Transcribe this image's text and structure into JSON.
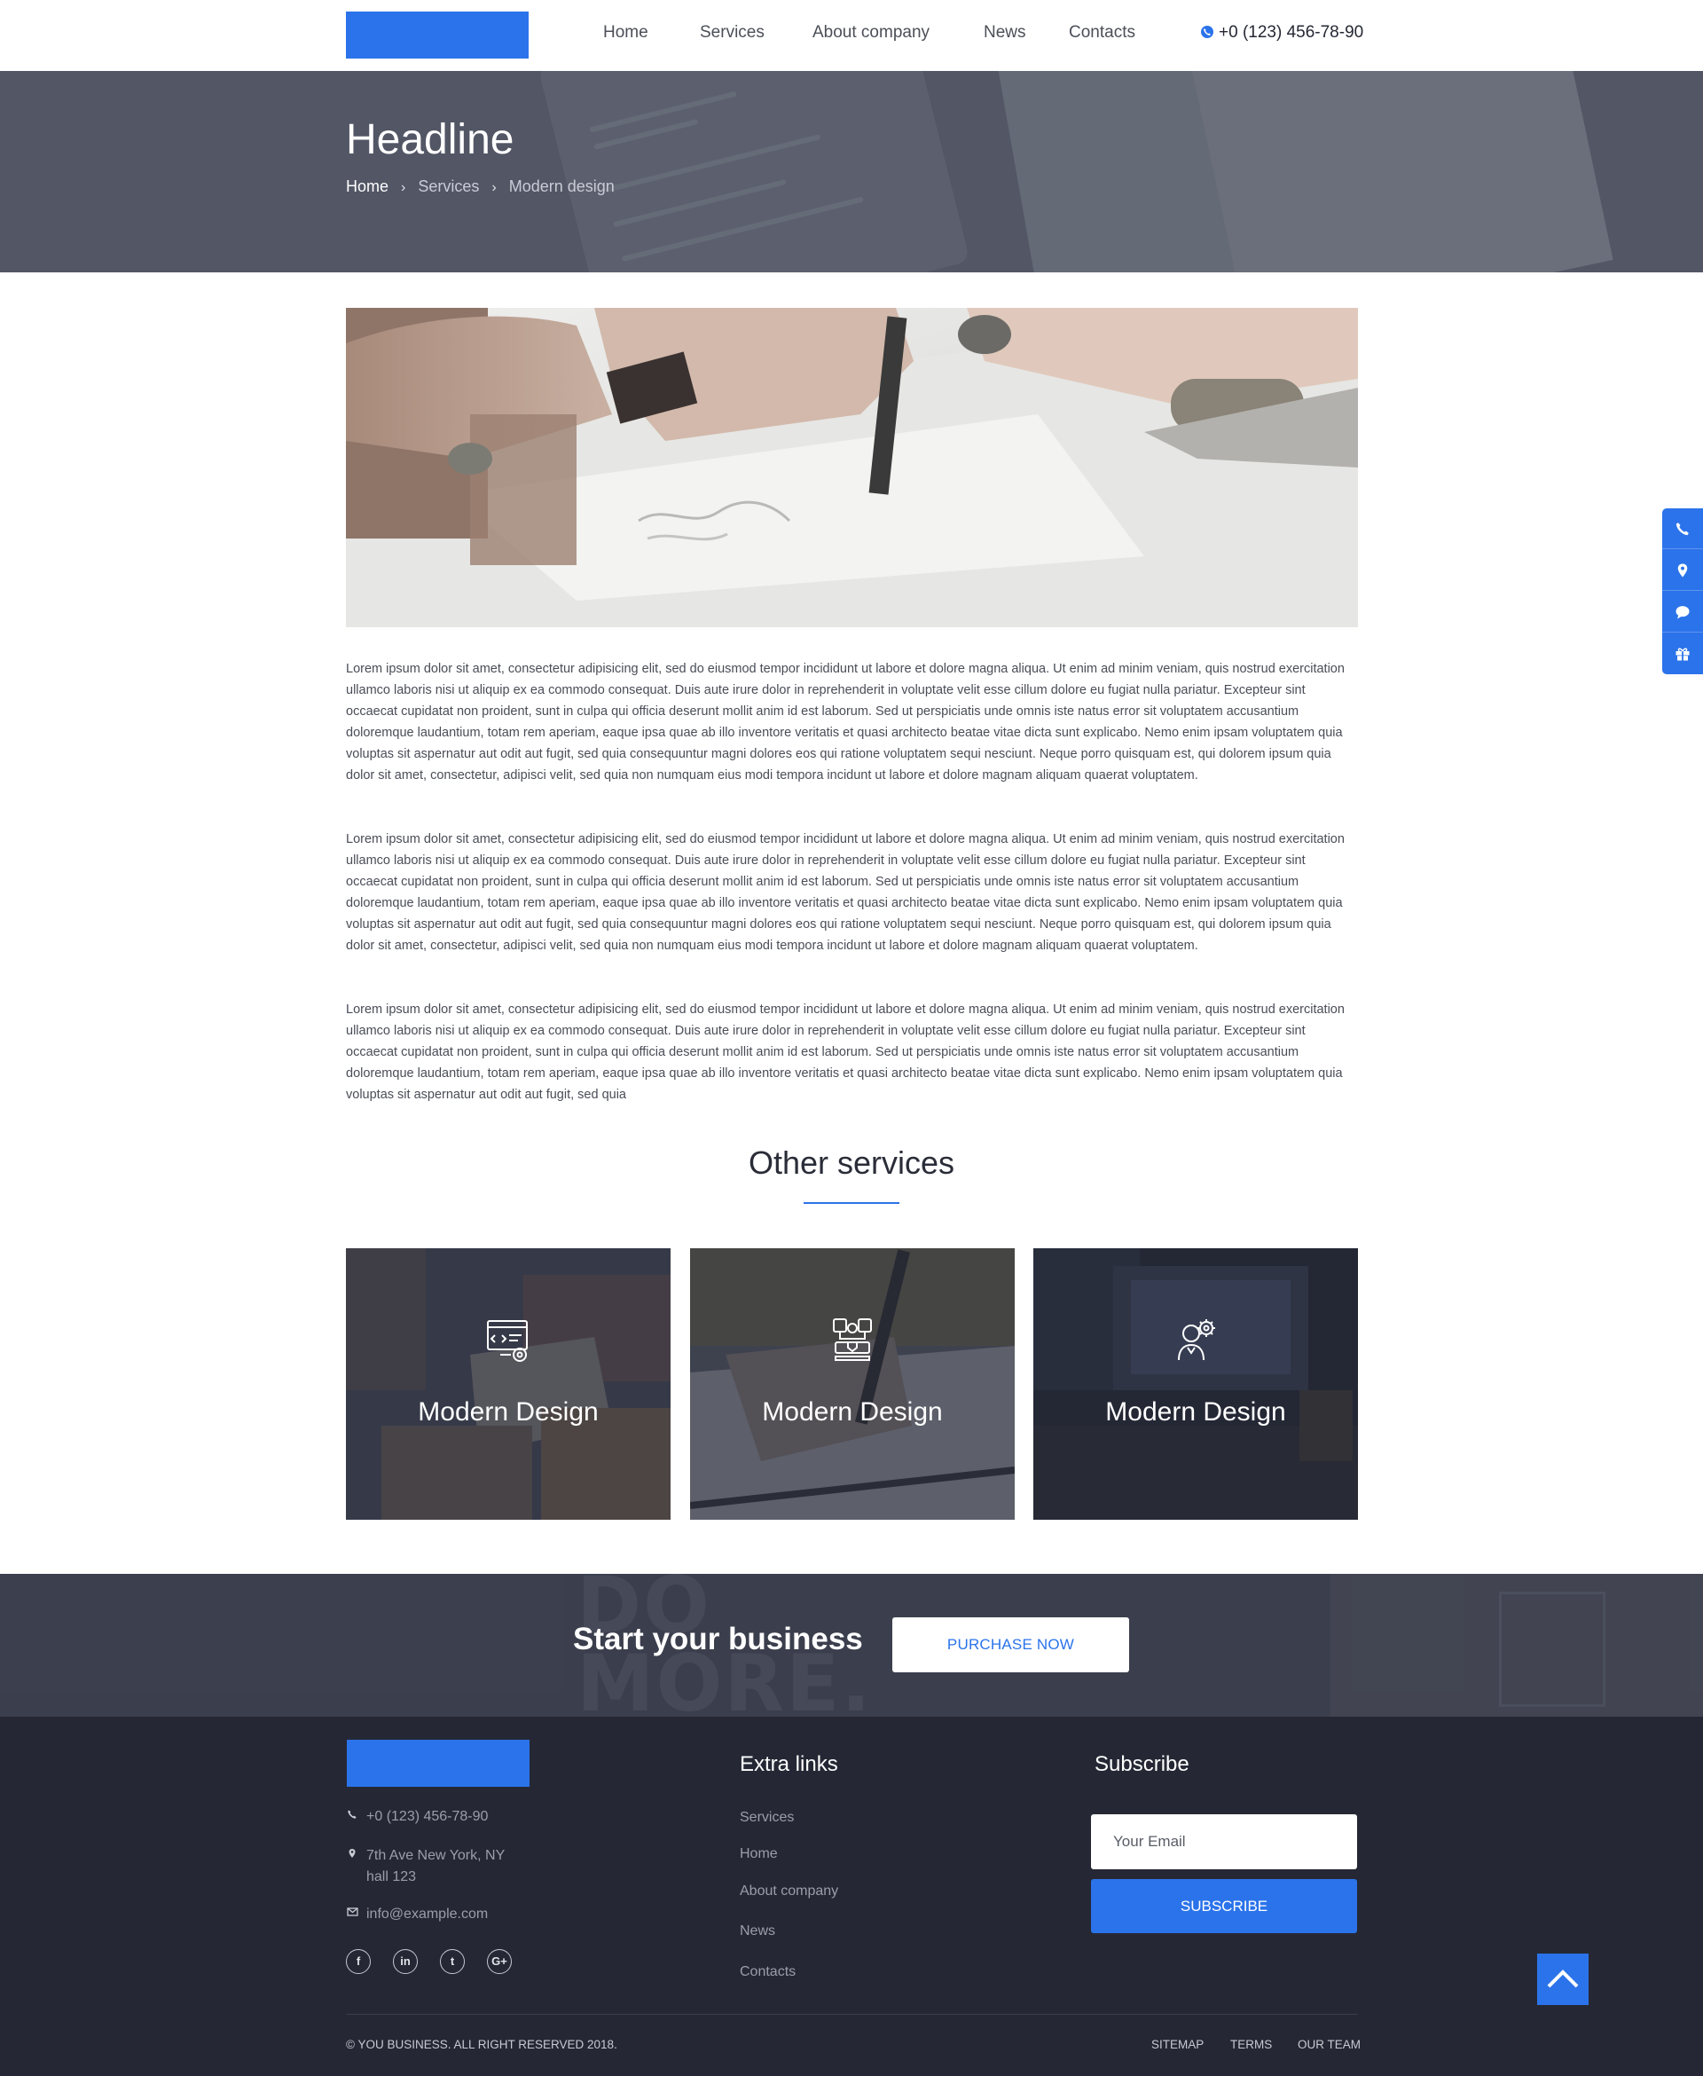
{
  "header": {
    "nav": [
      "Home",
      "Services",
      "About company",
      "News",
      "Contacts"
    ],
    "phone": "+0 (123) 456-78-90",
    "phone_icon": "phone-icon"
  },
  "hero": {
    "title": "Headline",
    "breadcrumbs": [
      "Home",
      "Services",
      "Modern design"
    ]
  },
  "content": {
    "paragraphs": [
      "Lorem ipsum dolor sit amet, consectetur adipisicing elit, sed do eiusmod tempor incididunt ut labore et dolore magna aliqua. Ut enim ad minim veniam, quis nostrud exercitation ullamco laboris nisi ut aliquip ex ea commodo consequat. Duis aute irure dolor in reprehenderit in voluptate velit esse cillum dolore eu fugiat nulla pariatur. Excepteur sint occaecat cupidatat non proident, sunt in culpa qui officia deserunt mollit anim id est laborum. Sed ut perspiciatis unde omnis iste natus error sit voluptatem accusantium doloremque laudantium, totam rem aperiam, eaque ipsa quae ab illo inventore veritatis et quasi architecto beatae vitae dicta sunt explicabo. Nemo enim ipsam voluptatem quia voluptas sit aspernatur aut odit aut fugit, sed quia consequuntur magni dolores eos qui ratione voluptatem sequi nesciunt. Neque porro quisquam est, qui dolorem ipsum quia dolor sit amet, consectetur, adipisci velit, sed quia non numquam eius modi tempora incidunt ut labore et dolore magnam aliquam quaerat voluptatem.",
      "Lorem ipsum dolor sit amet, consectetur adipisicing elit, sed do eiusmod tempor incididunt ut labore et dolore magna aliqua. Ut enim ad minim veniam, quis nostrud exercitation ullamco laboris nisi ut aliquip ex ea commodo consequat. Duis aute irure dolor in reprehenderit in voluptate velit esse cillum dolore eu fugiat nulla pariatur. Excepteur sint occaecat cupidatat non proident, sunt in culpa qui officia deserunt mollit anim id est laborum. Sed ut perspiciatis unde omnis iste natus error sit voluptatem accusantium doloremque laudantium, totam rem aperiam, eaque ipsa quae ab illo inventore veritatis et quasi architecto beatae vitae dicta sunt explicabo. Nemo enim ipsam voluptatem quia voluptas sit aspernatur aut odit aut fugit, sed quia consequuntur magni dolores eos qui ratione voluptatem sequi nesciunt. Neque porro quisquam est, qui dolorem ipsum quia dolor sit amet, consectetur, adipisci velit, sed quia non numquam eius modi tempora incidunt ut labore et dolore magnam aliquam quaerat voluptatem.",
      "Lorem ipsum dolor sit amet, consectetur adipisicing elit, sed do eiusmod tempor incididunt ut labore et dolore magna aliqua. Ut enim ad minim veniam, quis nostrud exercitation ullamco laboris nisi ut aliquip ex ea commodo consequat. Duis aute irure dolor in reprehenderit in voluptate velit esse cillum dolore eu fugiat nulla pariatur. Excepteur sint occaecat cupidatat non proident, sunt in culpa qui officia deserunt mollit anim id est laborum. Sed ut perspiciatis unde omnis iste natus error sit voluptatem accusantium doloremque laudantium, totam rem aperiam, eaque ipsa quae ab illo inventore veritatis et quasi architecto beatae vitae dicta sunt explicabo. Nemo enim ipsam voluptatem quia voluptas sit aspernatur aut odit aut fugit, sed quia"
    ]
  },
  "services": {
    "title": "Other services",
    "items": [
      {
        "title": "Modern Design",
        "icon": "web-design-icon"
      },
      {
        "title": "Modern Design",
        "icon": "design-tools-icon"
      },
      {
        "title": "Modern Design",
        "icon": "specialist-gear-icon"
      }
    ]
  },
  "cta": {
    "title": "Start your business",
    "button": "PURCHASE NOW",
    "background_text": [
      "DO",
      "MORE."
    ]
  },
  "footer": {
    "phone": "+0 (123) 456-78-90",
    "address_line1": "7th Ave New York, NY",
    "address_line2": "hall 123",
    "email": "info@example.com",
    "social": [
      {
        "icon": "facebook-icon",
        "glyph": "f"
      },
      {
        "icon": "linkedin-icon",
        "glyph": "in"
      },
      {
        "icon": "twitter-icon",
        "glyph": "t"
      },
      {
        "icon": "google-plus-icon",
        "glyph": "G+"
      }
    ],
    "extra_links_title": "Extra links",
    "extra_links": [
      "Services",
      "Home",
      "About company",
      "News",
      "Contacts"
    ],
    "subscribe_title": "Subscribe",
    "email_placeholder": "Your Email",
    "subscribe_button": "SUBSCRIBE",
    "copyright": "© YOU BUSINESS. ALL RIGHT RESERVED 2018.",
    "bottom_links": [
      "SITEMAP",
      "TERMS",
      "OUR TEAM"
    ]
  },
  "sidebar_icons": [
    "phone-icon",
    "map-pin-icon",
    "chat-icon",
    "gift-icon"
  ],
  "colors": {
    "accent": "#2b73ea",
    "footer_bg": "#252834",
    "hero_bg": "#5a5e6d"
  }
}
